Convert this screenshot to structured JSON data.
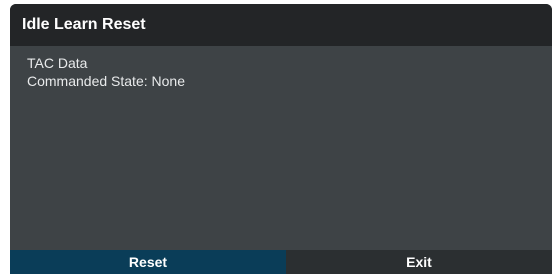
{
  "dialog": {
    "title": "Idle Learn Reset",
    "lines": [
      "TAC Data",
      "Commanded State: None"
    ],
    "buttons": {
      "reset_label": "Reset",
      "exit_label": "Exit"
    }
  },
  "colors": {
    "title_bar": "#232527",
    "body": "#3e4346",
    "primary_button": "#0a3d58",
    "secondary_button": "#2b2f31"
  }
}
